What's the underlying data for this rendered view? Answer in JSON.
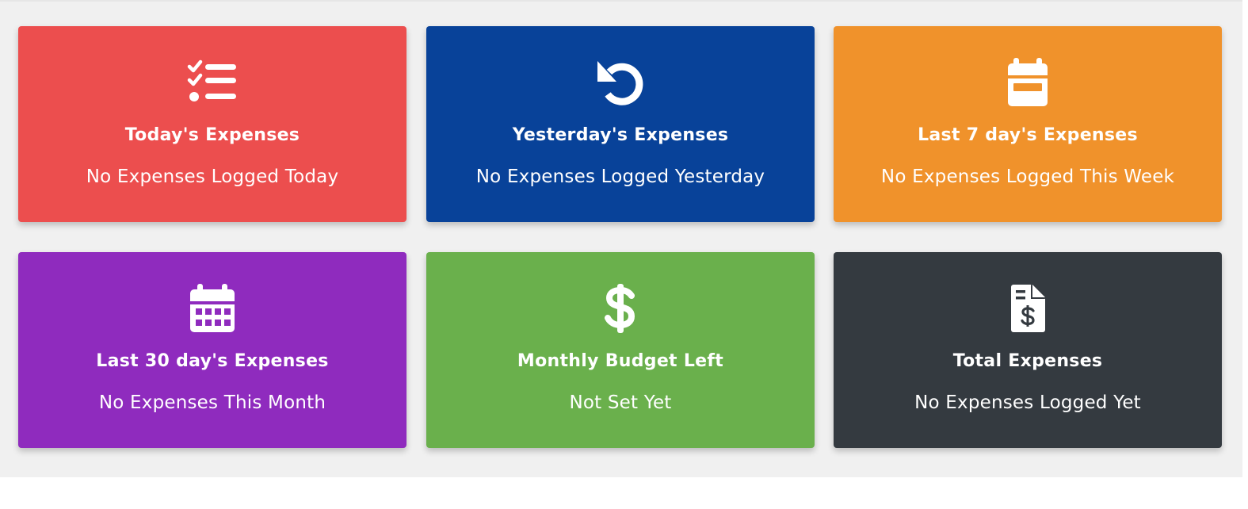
{
  "cards": [
    {
      "title": "Today's Expenses",
      "value": "No Expenses Logged Today",
      "icon": "tasks-icon",
      "color": "#ec4e4e"
    },
    {
      "title": "Yesterday's Expenses",
      "value": "No Expenses Logged Yesterday",
      "icon": "undo-icon",
      "color": "#084299"
    },
    {
      "title": "Last 7 day's Expenses",
      "value": "No Expenses Logged This Week",
      "icon": "calendar-week-icon",
      "color": "#f0922b"
    },
    {
      "title": "Last 30 day's Expenses",
      "value": "No Expenses This Month",
      "icon": "calendar-month-icon",
      "color": "#8f2bbe"
    },
    {
      "title": "Monthly Budget Left",
      "value": "Not Set Yet",
      "icon": "dollar-icon",
      "color": "#6ab04c"
    },
    {
      "title": "Total Expenses",
      "value": "No Expenses Logged Yet",
      "icon": "invoice-dollar-icon",
      "color": "#343a40"
    }
  ],
  "colors": {
    "page_background": "#f0f0f0",
    "text": "#ffffff"
  }
}
